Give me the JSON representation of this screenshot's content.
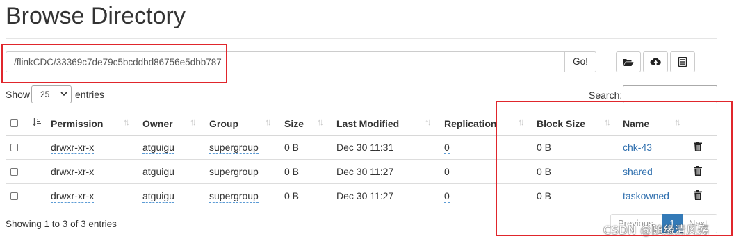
{
  "header": {
    "title": "Browse Directory"
  },
  "path_bar": {
    "value": "/flinkCDC/33369c7de79c5bcddbd86756e5dbb787",
    "go_label": "Go!"
  },
  "toolbar": {
    "icons": [
      "folder-open-icon",
      "upload-icon",
      "list-icon"
    ]
  },
  "controls": {
    "show_label": "Show",
    "entries_value": "25",
    "entries_label": "entries",
    "search_label": "Search:",
    "search_value": ""
  },
  "table": {
    "columns": [
      "Permission",
      "Owner",
      "Group",
      "Size",
      "Last Modified",
      "Replication",
      "Block Size",
      "Name"
    ],
    "rows": [
      {
        "permission": "drwxr-xr-x",
        "owner": "atguigu",
        "group": "supergroup",
        "size": "0 B",
        "modified": "Dec 30 11:31",
        "replication": "0",
        "block_size": "0 B",
        "name": "chk-43"
      },
      {
        "permission": "drwxr-xr-x",
        "owner": "atguigu",
        "group": "supergroup",
        "size": "0 B",
        "modified": "Dec 30 11:27",
        "replication": "0",
        "block_size": "0 B",
        "name": "shared"
      },
      {
        "permission": "drwxr-xr-x",
        "owner": "atguigu",
        "group": "supergroup",
        "size": "0 B",
        "modified": "Dec 30 11:27",
        "replication": "0",
        "block_size": "0 B",
        "name": "taskowned"
      }
    ]
  },
  "footer": {
    "info": "Showing 1 to 3 of 3 entries",
    "prev_label": "Previous",
    "page": "1",
    "next_label": "Next"
  },
  "watermark": "CSDN @随缘清风殇",
  "colors": {
    "highlight": "#e0262c",
    "link": "#2f6fae",
    "active_page": "#337ab7"
  }
}
